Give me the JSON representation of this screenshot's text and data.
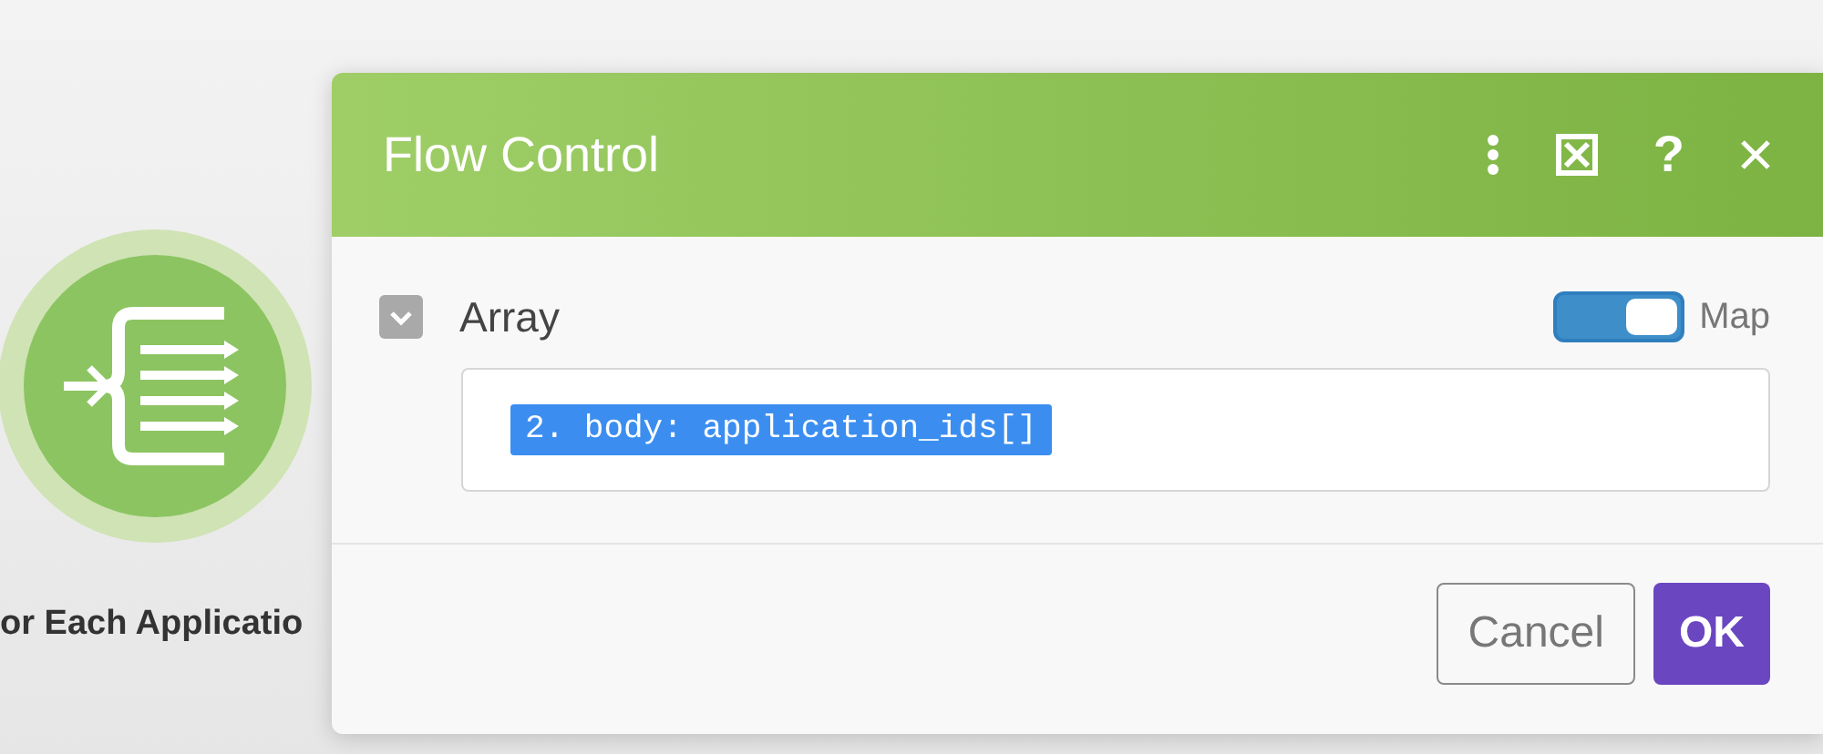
{
  "node": {
    "label": "or Each Applicatio"
  },
  "dialog": {
    "title": "Flow Control",
    "header_icons": [
      {
        "kind": "menu"
      },
      {
        "kind": "fullscreen"
      },
      {
        "kind": "help",
        "label": "?"
      },
      {
        "kind": "close"
      }
    ],
    "field": {
      "label": "Array",
      "map_toggle": {
        "label": "Map",
        "on": true
      },
      "token": "2. body: application_ids[]"
    },
    "buttons": [
      {
        "label": "Cancel",
        "kind": "secondary"
      },
      {
        "label": "OK",
        "kind": "primary"
      }
    ]
  }
}
